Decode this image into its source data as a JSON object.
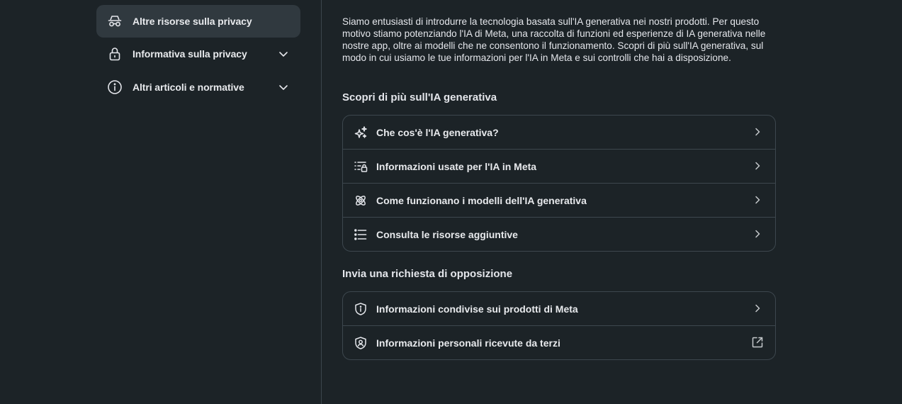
{
  "sidebar": {
    "items": [
      {
        "label": "Altre risorse sulla privacy",
        "icon": "incognito-icon",
        "active": true
      },
      {
        "label": "Informativa sulla privacy",
        "icon": "lock-icon",
        "expandable": true
      },
      {
        "label": "Altri articoli e normative",
        "icon": "info-icon",
        "expandable": true
      }
    ]
  },
  "main": {
    "intro": "Siamo entusiasti di introdurre la tecnologia basata sull'IA generativa nei nostri prodotti. Per questo motivo stiamo potenziando l'IA di Meta, una raccolta di funzioni ed esperienze di IA generativa nelle nostre app, oltre ai modelli che ne consentono il funzionamento. Scopri di più sull'IA generativa, sul modo in cui usiamo le tue informazioni per l'IA in Meta e sui controlli che hai a disposizione.",
    "learn_section": {
      "title": "Scopri di più sull'IA generativa",
      "items": [
        {
          "label": "Che cos'è l'IA generativa?",
          "icon": "sparkles-icon"
        },
        {
          "label": "Informazioni usate per l'IA in Meta",
          "icon": "list-lock-icon"
        },
        {
          "label": "Come funzionano i modelli dell'IA generativa",
          "icon": "atom-icon"
        },
        {
          "label": "Consulta le risorse aggiuntive",
          "icon": "bullet-list-icon"
        }
      ]
    },
    "objection_section": {
      "title": "Invia una richiesta di opposizione",
      "items": [
        {
          "label": "Informazioni condivise sui prodotti di Meta",
          "icon": "shield-info-icon",
          "trailing": "chevron-right-icon"
        },
        {
          "label": "Informazioni personali ricevute da terzi",
          "icon": "shield-person-icon",
          "trailing": "external-link-icon"
        }
      ]
    }
  },
  "colors": {
    "background": "#1c2327",
    "active_item": "#30393f",
    "border": "#3d474e",
    "text": "#e4e6eb"
  }
}
